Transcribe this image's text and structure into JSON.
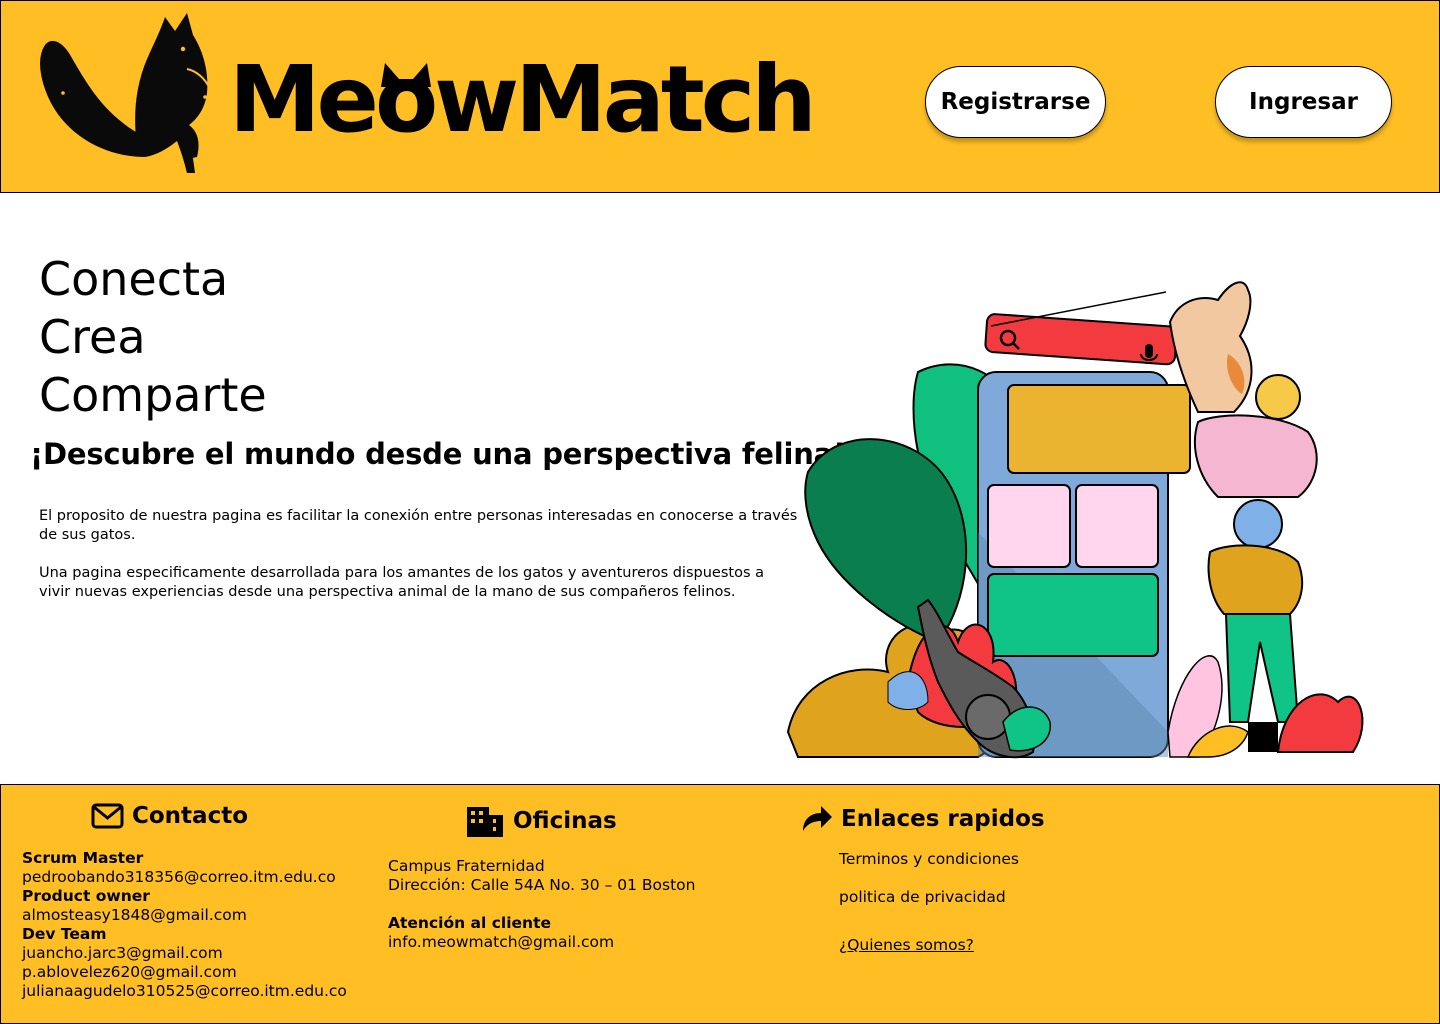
{
  "header": {
    "brand": "MeowMatch",
    "register_label": "Registrarse",
    "login_label": "Ingresar"
  },
  "hero": {
    "tagline": [
      "Conecta",
      "Crea",
      "Comparte"
    ],
    "subtitle": "¡Descubre el mundo desde una perspectiva felina!",
    "paragraphs": [
      "El proposito de nuestra pagina es facilitar la conexión entre personas interesadas en conocerse a través de sus gatos.",
      "Una pagina especificamente desarrollada para los amantes de los gatos y aventureros dispuestos a vivir nuevas experiencias desde una perspectiva animal de la mano de sus compañeros felinos."
    ]
  },
  "footer": {
    "contact": {
      "heading": "Contacto",
      "scrum_label": "Scrum Master",
      "scrum_email": "pedroobando318356@correo.itm.edu.co",
      "po_label": "Product owner",
      "po_email": "almosteasy1848@gmail.com",
      "dev_label": "Dev Team",
      "dev_emails": [
        "juancho.jarc3@gmail.com",
        "p.ablovelez620@gmail.com",
        "julianaagudelo310525@correo.itm.edu.co"
      ]
    },
    "offices": {
      "heading": "Oficinas",
      "campus": "Campus Fraternidad",
      "address": "Dirección: Calle 54A No. 30 – 01 Boston",
      "support_label": "Atención al cliente",
      "support_email": "info.meowmatch@gmail.com"
    },
    "links": {
      "heading": "Enlaces rapidos",
      "terms": "Terminos y condiciones",
      "privacy": "politica de privacidad",
      "about": "¿Quienes somos?"
    }
  },
  "colors": {
    "brand_yellow": "#ffbf24",
    "search_red": "#f33a3f",
    "phone_blue": "#7fa9d8",
    "card_green": "#10c488",
    "card_pink": "#ffd6ee",
    "leaf_green": "#0a8a55"
  },
  "icons": [
    "cat-logo-icon",
    "envelope-icon",
    "building-icon",
    "share-arrow-icon",
    "search-icon",
    "microphone-icon"
  ]
}
